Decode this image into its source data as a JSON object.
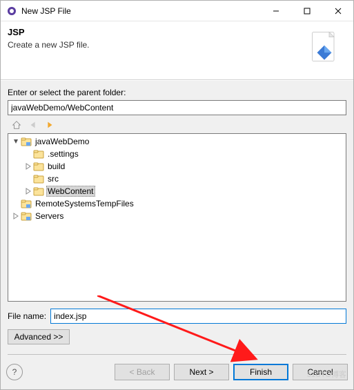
{
  "window": {
    "title": "New JSP File"
  },
  "header": {
    "title": "JSP",
    "description": "Create a new JSP file."
  },
  "parent_folder": {
    "label": "Enter or select the parent folder:",
    "value": "javaWebDemo/WebContent"
  },
  "tree": {
    "items": [
      {
        "label": "javaWebDemo",
        "icon": "project-icon",
        "depth": 0,
        "expanded": true
      },
      {
        "label": ".settings",
        "icon": "folder-icon",
        "depth": 1,
        "expanded": null
      },
      {
        "label": "build",
        "icon": "folder-icon",
        "depth": 1,
        "expanded": false
      },
      {
        "label": "src",
        "icon": "folder-icon",
        "depth": 1,
        "expanded": null
      },
      {
        "label": "WebContent",
        "icon": "folder-icon",
        "depth": 1,
        "expanded": false,
        "selected": true
      },
      {
        "label": "RemoteSystemsTempFiles",
        "icon": "project-icon",
        "depth": 0,
        "expanded": null
      },
      {
        "label": "Servers",
        "icon": "project-icon",
        "depth": 0,
        "expanded": false
      }
    ]
  },
  "filename": {
    "label": "File name:",
    "value": "index.jsp"
  },
  "advanced_label": "Advanced >>",
  "buttons": {
    "back": "< Back",
    "next": "Next >",
    "finish": "Finish",
    "cancel": "Cancel"
  },
  "watermark": "51CTO博客"
}
